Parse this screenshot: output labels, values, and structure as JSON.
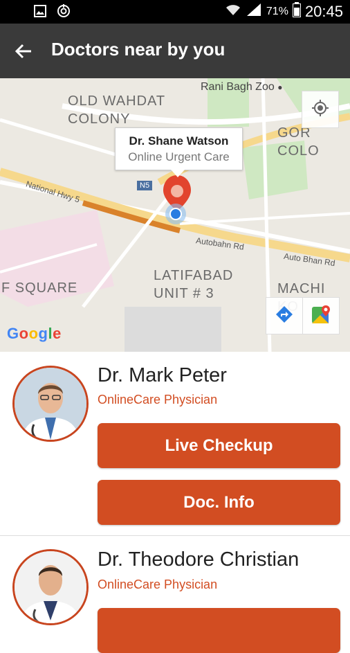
{
  "status_bar": {
    "battery_percent": "71%",
    "time": "20:45"
  },
  "app_bar": {
    "title": "Doctors near by you"
  },
  "map": {
    "labels": {
      "old_wahdat": "OLD WAHDAT\nCOLONY",
      "gor_colony": "GOR COLO",
      "zoo": "Rani Bagh Zoo",
      "f_square": "F SQUARE",
      "latifabad": "LATIFABAD\nUNIT # 3",
      "machi": "MACHI KO",
      "national_hwy": "National Hwy 5",
      "n5_badge": "N5",
      "autobahn1": "Autobahn Rd",
      "autobahn2": "Auto Bhan Rd"
    },
    "callout": {
      "name": "Dr. Shane Watson",
      "subtitle": "Online Urgent Care"
    },
    "google_logo": "Google"
  },
  "doctors": [
    {
      "name": "Dr. Mark Peter",
      "role": "OnlineCare Physician",
      "primary_button": "Live Checkup",
      "secondary_button": "Doc. Info"
    },
    {
      "name": "Dr. Theodore  Christian",
      "role": "OnlineCare Physician"
    }
  ],
  "colors": {
    "accent": "#d24d22",
    "app_bar": "#3a3a3a",
    "status_bar": "#000000"
  }
}
